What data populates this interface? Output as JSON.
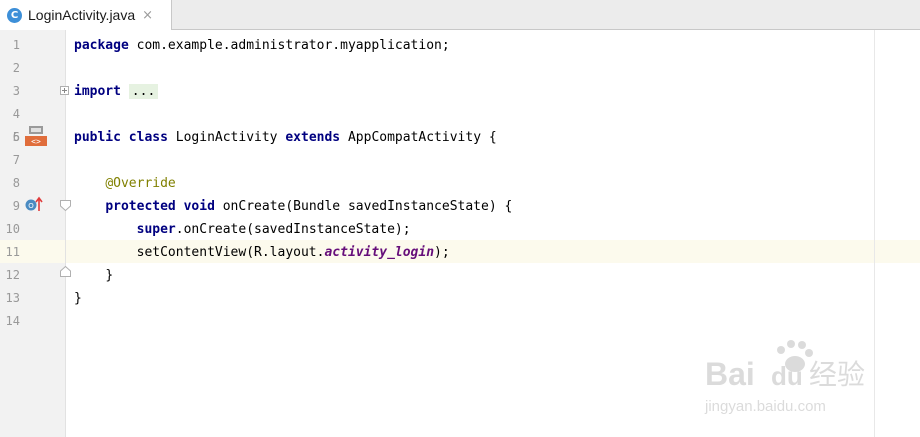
{
  "editor_tab": {
    "icon_letter": "C",
    "title": "LoginActivity.java",
    "close_glyph": "×"
  },
  "lines": [
    {
      "num": "1"
    },
    {
      "num": "2"
    },
    {
      "num": "3"
    },
    {
      "num": "4"
    },
    {
      "num": "5"
    },
    {
      "num": "6"
    },
    {
      "num": "7"
    },
    {
      "num": "8"
    },
    {
      "num": "9"
    },
    {
      "num": "10"
    },
    {
      "num": "11"
    },
    {
      "num": "12"
    },
    {
      "num": "13"
    },
    {
      "num": "14"
    }
  ],
  "code": {
    "l1_kw": "package",
    "l1_rest": " com.example.administrator.myapplication;",
    "l3_kw": "import",
    "l3_folded": "...",
    "l6_kw1": "public",
    "l6_kw2": "class",
    "l6_name": " LoginActivity ",
    "l6_kw3": "extends",
    "l6_rest": " AppCompatActivity {",
    "l8_ann": "@Override",
    "l9_kw1": "protected",
    "l9_kw2": "void",
    "l9_rest": " onCreate(Bundle savedInstanceState) {",
    "l10_kw": "super",
    "l10_rest": ".onCreate(savedInstanceState);",
    "l11_pre": "setContentView(R.layout.",
    "l11_field": "activity_login",
    "l11_post": ");",
    "l12": "}",
    "l13": "}"
  },
  "gutter_icons": {
    "implements_icon": "<>",
    "override_icon": "O"
  },
  "watermark": {
    "brand": "Bai",
    "brand2": "du",
    "cn": "经验",
    "url": "jingyan.baidu.com"
  },
  "colors": {
    "keyword": "#000080",
    "annotation": "#808000",
    "field": "#660e7a",
    "current_line": "#fcfaed",
    "tab_icon": "#3d8fd8"
  }
}
